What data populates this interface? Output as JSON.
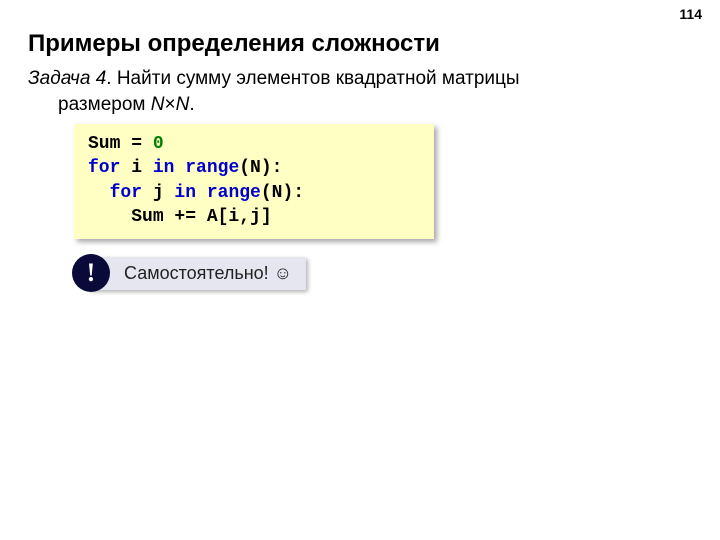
{
  "page_number": "114",
  "title": "Примеры определения сложности",
  "task": {
    "label": "Задача 4",
    "body_line1": ". Найти сумму элементов квадратной матрицы",
    "body_line2_prefix": "размером ",
    "n1": "N",
    "times": "×",
    "n2": "N",
    "body_line2_suffix": "."
  },
  "code": {
    "l1_a": "Sum",
    "l1_b": " = ",
    "l1_c": "0",
    "l2_a": "for",
    "l2_b": " i ",
    "l2_c": "in",
    "l2_d": " ",
    "l2_e": "range",
    "l2_f": "(N):",
    "l3_pad": "  ",
    "l3_a": "for",
    "l3_b": " j ",
    "l3_c": "in",
    "l3_d": " ",
    "l3_e": "range",
    "l3_f": "(N):",
    "l4_pad": "    ",
    "l4_a": "Sum += A[i,j]"
  },
  "note": {
    "icon": "!",
    "text": " Самостоятельно! ☺"
  }
}
